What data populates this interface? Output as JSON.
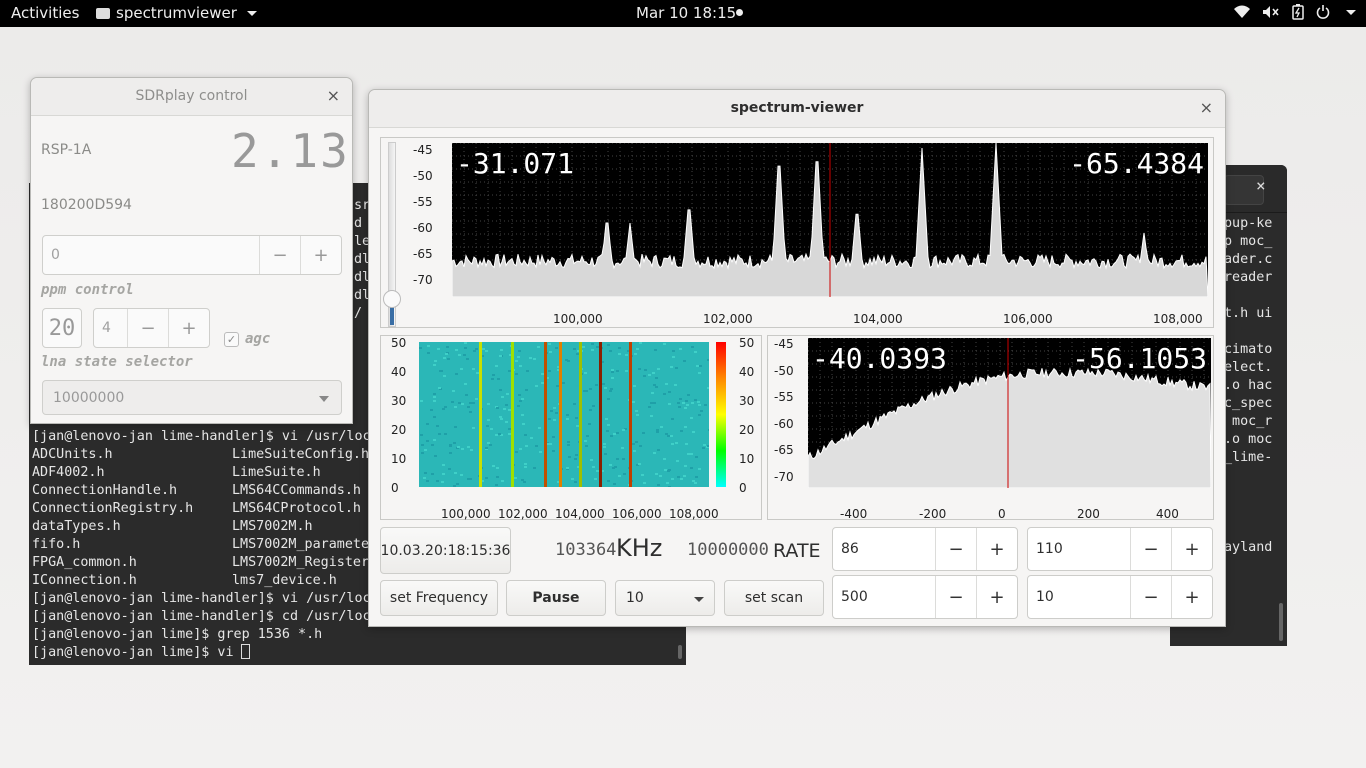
{
  "topbar": {
    "activities": "Activities",
    "app_name": "spectrumviewer",
    "clock": "Mar 10  18:15"
  },
  "terminal_main": {
    "partial_lines": [
      {
        "row": 0,
        "text": "sr/"
      },
      {
        "row": 1,
        "text": "d"
      },
      {
        "row": 2,
        "text": "le"
      },
      {
        "row": 3,
        "text": "dl"
      },
      {
        "row": 4,
        "text": "dl"
      },
      {
        "row": 5,
        "text": "dl"
      },
      {
        "row": 6,
        "text": "/"
      }
    ],
    "lines": [
      {
        "left": "[jan@lenovo-jan lime-handler]$ vi /usr/loc",
        "right": ""
      },
      {
        "left": "ADCUnits.h",
        "right": "LimeSuiteConfig.h"
      },
      {
        "left": "ADF4002.h",
        "right": "LimeSuite.h"
      },
      {
        "left": "ConnectionHandle.h",
        "right": "LMS64CCommands.h"
      },
      {
        "left": "ConnectionRegistry.h",
        "right": "LMS64CProtocol.h"
      },
      {
        "left": "dataTypes.h",
        "right": "LMS7002M.h"
      },
      {
        "left": "fifo.h",
        "right": "LMS7002M_paramete"
      },
      {
        "left": "FPGA_common.h",
        "right": "LMS7002M_Register"
      },
      {
        "left": "IConnection.h",
        "right": "lms7_device.h"
      },
      {
        "left": "[jan@lenovo-jan lime-handler]$ vi /usr/loc",
        "right": ""
      },
      {
        "left": "[jan@lenovo-jan lime-handler]$ cd /usr/loc",
        "right": ""
      },
      {
        "left": "[jan@lenovo-jan lime]$ grep 1536 *.h",
        "right": ""
      },
      {
        "left": "[jan@lenovo-jan lime]$ vi ",
        "right": ""
      }
    ]
  },
  "terminal_back": {
    "lines": [
      "pup-ke",
      "p moc_",
      "ader.c",
      "reader",
      "",
      "t.h ui",
      "",
      "cimato",
      "elect.",
      ".o hac",
      "c_spec",
      " moc_r",
      ".o moc",
      "_lime-",
      "",
      "",
      "",
      "",
      "ayland"
    ]
  },
  "sdrplay": {
    "title": "SDRplay control",
    "model": "RSP-1A",
    "version_display": "2.13",
    "serial": "180200D594",
    "ppm_value": "0",
    "ppm_label": "ppm control",
    "gain_display": "20",
    "lna_value": "4",
    "agc_label": "agc",
    "lna_label": "lna state selector",
    "bandwidth_value": "10000000"
  },
  "spectrum": {
    "title": "spectrum-viewer",
    "main_left_value": "-31.071",
    "main_right_value": "-65.4384",
    "main_y_ticks": [
      "-45",
      "-50",
      "-55",
      "-60",
      "-65",
      "-70"
    ],
    "main_x_ticks": [
      "100,000",
      "102,000",
      "104,000",
      "106,000",
      "108,000"
    ],
    "wf_y_ticks": [
      "50",
      "40",
      "30",
      "20",
      "10",
      "0"
    ],
    "wf_x_ticks": [
      "100,000",
      "102,000",
      "104,000",
      "106,000",
      "108,000"
    ],
    "wf_scale_ticks": [
      "50",
      "40",
      "30",
      "20",
      "10",
      "0"
    ],
    "zoom_left_value": "-40.0393",
    "zoom_right_value": "-56.1053",
    "zoom_y_ticks": [
      "-45",
      "-50",
      "-55",
      "-60",
      "-65",
      "-70"
    ],
    "zoom_x_ticks": [
      "-400",
      "-200",
      "0",
      "200",
      "400"
    ],
    "timestamp": "10.03.20:18:15:36",
    "freq_display": "103364",
    "freq_unit": "KHz",
    "rate_display": "10000000",
    "rate_label": "RATE",
    "spin1_value": "86",
    "spin2_value": "110",
    "spin3_value": "500",
    "spin4_value": "10",
    "set_frequency_label": "set Frequency",
    "pause_label": "Pause",
    "combo_value": "10",
    "set_scan_label": "set scan",
    "minus": "−",
    "plus": "+",
    "close": "×"
  },
  "icons": {
    "wifi": "wifi-icon",
    "volume": "volume-muted-icon",
    "battery": "battery-icon",
    "power": "power-icon"
  }
}
